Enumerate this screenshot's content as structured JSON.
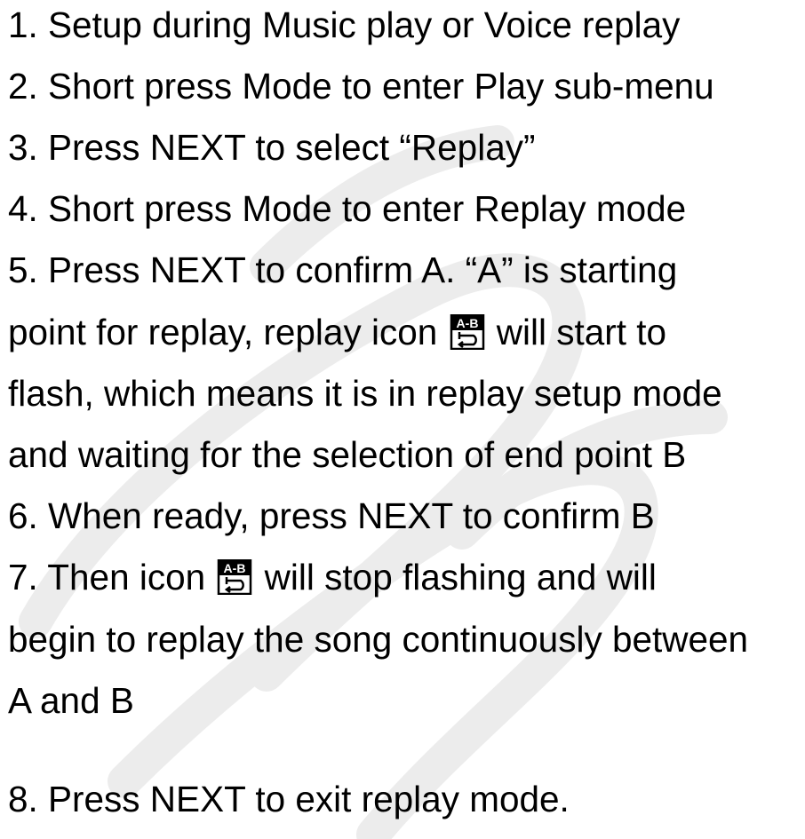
{
  "lines": [
    {
      "before": "1. Setup during Music play or Voice replay"
    },
    {
      "before": "2. Short press Mode to enter Play sub-menu"
    },
    {
      "before": "3. Press NEXT to select “Replay”"
    },
    {
      "before": "4. Short press Mode to enter Replay mode"
    },
    {
      "before": "5. Press NEXT to confirm A. “A” is starting"
    },
    {
      "before": "point for replay, replay icon ",
      "after": " will start to",
      "icon": "ab-replay-icon"
    },
    {
      "before": "flash, which means it is in replay setup mode"
    },
    {
      "before": "and waiting for the selection of end point B"
    },
    {
      "before": "6. When ready, press NEXT to confirm B"
    },
    {
      "before": "7. Then icon ",
      "after": " will stop flashing and will",
      "icon": "ab-replay-icon"
    },
    {
      "before": "begin to replay the song continuously between"
    },
    {
      "before": "A and B"
    },
    {
      "before": "8. Press NEXT to exit replay mode."
    }
  ],
  "icon": {
    "name": "ab-replay-icon",
    "label": "A-B"
  },
  "watermark": {
    "color": "#e8e8e8"
  }
}
